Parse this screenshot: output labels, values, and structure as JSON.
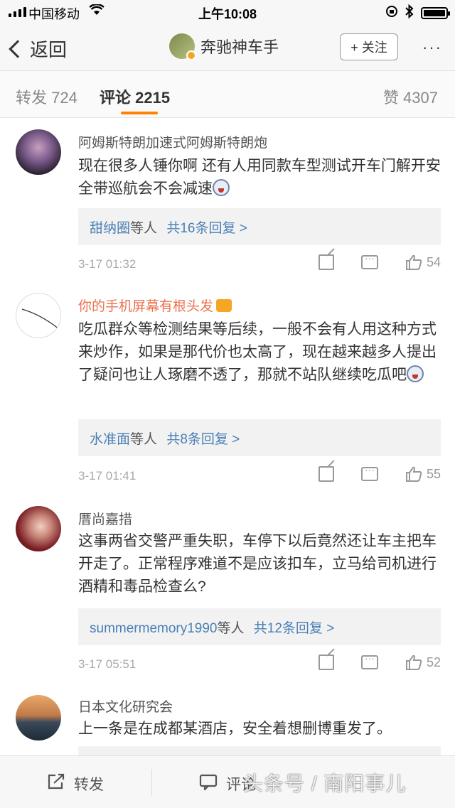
{
  "status_bar": {
    "carrier": "中国移动",
    "time": "上午10:08"
  },
  "nav": {
    "back_label": "返回",
    "username": "奔驰神车手",
    "follow_label": "+ 关注",
    "more_label": "···"
  },
  "tabs": {
    "reposts": "转发 724",
    "comments": "评论 2215",
    "likes": "赞 4307"
  },
  "comments": [
    {
      "username": "阿姆斯特朗加速式阿姆斯特朗炮",
      "text": "现在很多人锤你啊 还有人用同款车型测试开车门解开安全带巡航会不会减速",
      "reply_names": "甜纳圈",
      "reply_mid": "等人",
      "reply_count": "共16条回复 >",
      "timestamp": "3-17 01:32",
      "likes": "54"
    },
    {
      "username": "你的手机屏幕有根头发",
      "text": "吃瓜群众等检测结果等后续，一般不会有人用这种方式来炒作，如果是那代价也太高了，现在越来越多人提出了疑问也让人琢磨不透了，那就不站队继续吃瓜吧",
      "reply_names": "水准面",
      "reply_mid": "等人",
      "reply_count": "共8条回复 >",
      "timestamp": "3-17 01:41",
      "likes": "55"
    },
    {
      "username": "厝尚嘉措",
      "text": "这事两省交警严重失职，车停下以后竟然还让车主把车开走了。正常程序难道不是应该扣车，立马给司机进行酒精和毒品检查么?",
      "reply_names": "summermemory1990",
      "reply_mid": "等人",
      "reply_count": "共12条回复 >",
      "timestamp": "3-17 05:51",
      "likes": "52"
    },
    {
      "username": "日本文化研究会",
      "text": "上一条是在成都某酒店，安全着想删博重发了。"
    }
  ],
  "bottom": {
    "repost_label": "转发",
    "comment_label": "评论"
  },
  "watermark": "头条号 / 南阳事儿",
  "colors": {
    "accent": "#ff8200",
    "link": "#4a7fb5",
    "vip_name": "#eb7350"
  }
}
